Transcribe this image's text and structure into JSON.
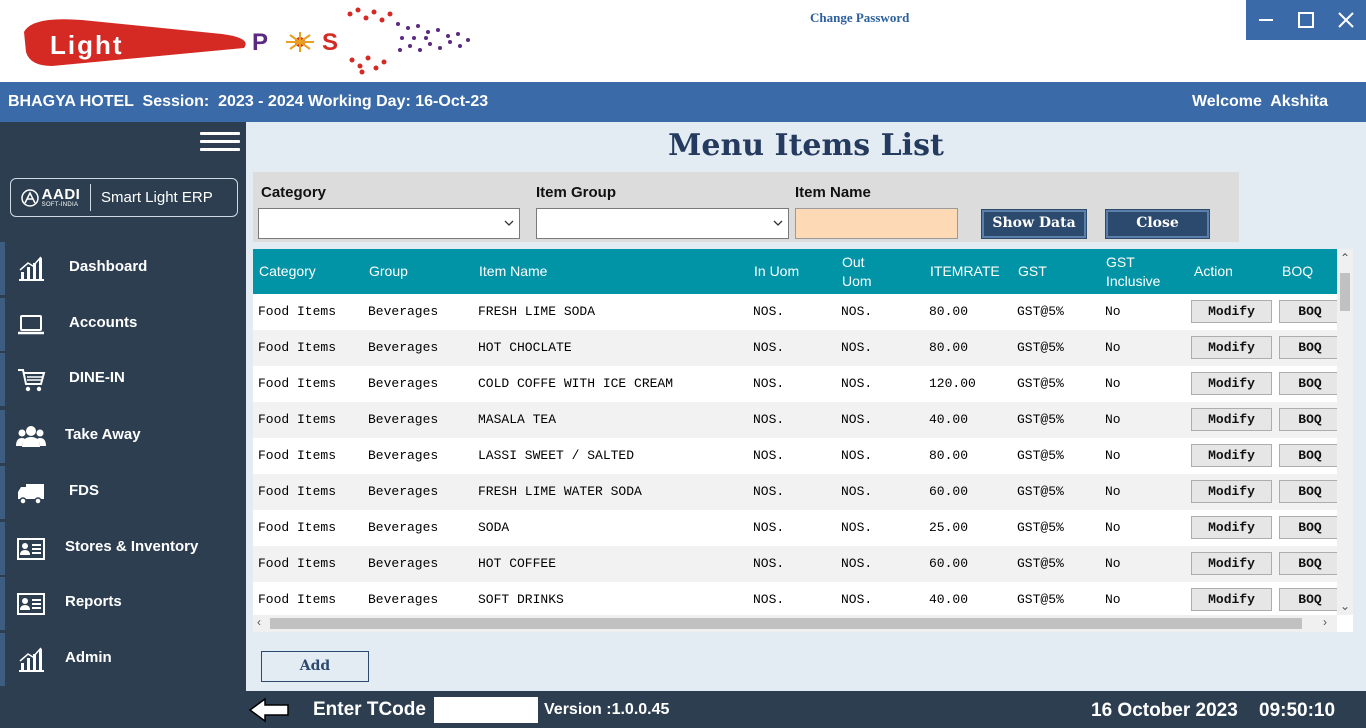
{
  "brand": {
    "logo_text": "LightPOS"
  },
  "header": {
    "change_password": "Change Password"
  },
  "session": {
    "text": "BHAGYA HOTEL  Session:  2023 - 2024 Working Day: 16-Oct-23",
    "welcome": "Welcome  Akshita"
  },
  "sidebar": {
    "badge_name": "AADI",
    "badge_sub": "SOFT-INDIA",
    "badge_product": "Smart Light ERP",
    "items": [
      {
        "label": "Dashboard",
        "icon": "bar-chart-icon"
      },
      {
        "label": "Accounts",
        "icon": "laptop-icon"
      },
      {
        "label": "DINE-IN",
        "icon": "shopping-cart-icon"
      },
      {
        "label": "Take Away",
        "icon": "users-icon"
      },
      {
        "label": "FDS",
        "icon": "truck-icon"
      },
      {
        "label": "Stores & Inventory",
        "icon": "id-card-icon"
      },
      {
        "label": "Reports",
        "icon": "id-card-icon"
      },
      {
        "label": "Admin",
        "icon": "bar-chart-icon"
      }
    ]
  },
  "page": {
    "title": "Menu Items List",
    "filters": {
      "category_label": "Category",
      "category_value": "",
      "group_label": "Item Group",
      "group_value": "",
      "item_name_label": "Item Name",
      "item_name_value": "",
      "show_button": "Show Data",
      "close_button": "Close"
    },
    "columns": [
      "Category",
      "Group",
      "Item Name",
      "In Uom",
      "Out Uom",
      "ITEMRATE",
      "GST",
      "GST Inclusive",
      "Action",
      "BOQ"
    ],
    "rows": [
      {
        "category": "Food Items",
        "group": "Beverages",
        "item": "FRESH LIME SODA",
        "in_uom": "NOS.",
        "out_uom": "NOS.",
        "rate": "80.00",
        "gst": "GST@5%",
        "inclusive": "No",
        "action": "Modify",
        "boq": "BOQ"
      },
      {
        "category": "Food Items",
        "group": "Beverages",
        "item": "HOT CHOCLATE",
        "in_uom": "NOS.",
        "out_uom": "NOS.",
        "rate": "80.00",
        "gst": "GST@5%",
        "inclusive": "No",
        "action": "Modify",
        "boq": "BOQ"
      },
      {
        "category": "Food Items",
        "group": "Beverages",
        "item": "COLD COFFE WITH ICE CREAM",
        "in_uom": "NOS.",
        "out_uom": "NOS.",
        "rate": "120.00",
        "gst": "GST@5%",
        "inclusive": "No",
        "action": "Modify",
        "boq": "BOQ"
      },
      {
        "category": "Food Items",
        "group": "Beverages",
        "item": "MASALA TEA",
        "in_uom": "NOS.",
        "out_uom": "NOS.",
        "rate": "40.00",
        "gst": "GST@5%",
        "inclusive": "No",
        "action": "Modify",
        "boq": "BOQ"
      },
      {
        "category": "Food Items",
        "group": "Beverages",
        "item": "LASSI SWEET / SALTED",
        "in_uom": "NOS.",
        "out_uom": "NOS.",
        "rate": "80.00",
        "gst": "GST@5%",
        "inclusive": "No",
        "action": "Modify",
        "boq": "BOQ"
      },
      {
        "category": "Food Items",
        "group": "Beverages",
        "item": "FRESH LIME WATER SODA",
        "in_uom": "NOS.",
        "out_uom": "NOS.",
        "rate": "60.00",
        "gst": "GST@5%",
        "inclusive": "No",
        "action": "Modify",
        "boq": "BOQ"
      },
      {
        "category": "Food Items",
        "group": "Beverages",
        "item": "SODA",
        "in_uom": "NOS.",
        "out_uom": "NOS.",
        "rate": "25.00",
        "gst": "GST@5%",
        "inclusive": "No",
        "action": "Modify",
        "boq": "BOQ"
      },
      {
        "category": "Food Items",
        "group": "Beverages",
        "item": "HOT COFFEE",
        "in_uom": "NOS.",
        "out_uom": "NOS.",
        "rate": "60.00",
        "gst": "GST@5%",
        "inclusive": "No",
        "action": "Modify",
        "boq": "BOQ"
      },
      {
        "category": "Food Items",
        "group": "Beverages",
        "item": "SOFT DRINKS",
        "in_uom": "NOS.",
        "out_uom": "NOS.",
        "rate": "40.00",
        "gst": "GST@5%",
        "inclusive": "No",
        "action": "Modify",
        "boq": "BOQ"
      }
    ],
    "add_button": "Add"
  },
  "footer": {
    "tcode_label": "Enter TCode",
    "tcode_value": "",
    "version": "Version :1.0.0.45",
    "date": "16 October 2023",
    "time": "09:50:10"
  },
  "colors": {
    "header_blue": "#3a6aa8",
    "sidebar": "#2c3e50",
    "grid_header": "#0094a6",
    "title": "#243a5e",
    "item_name_bg": "#fdd9b5"
  }
}
